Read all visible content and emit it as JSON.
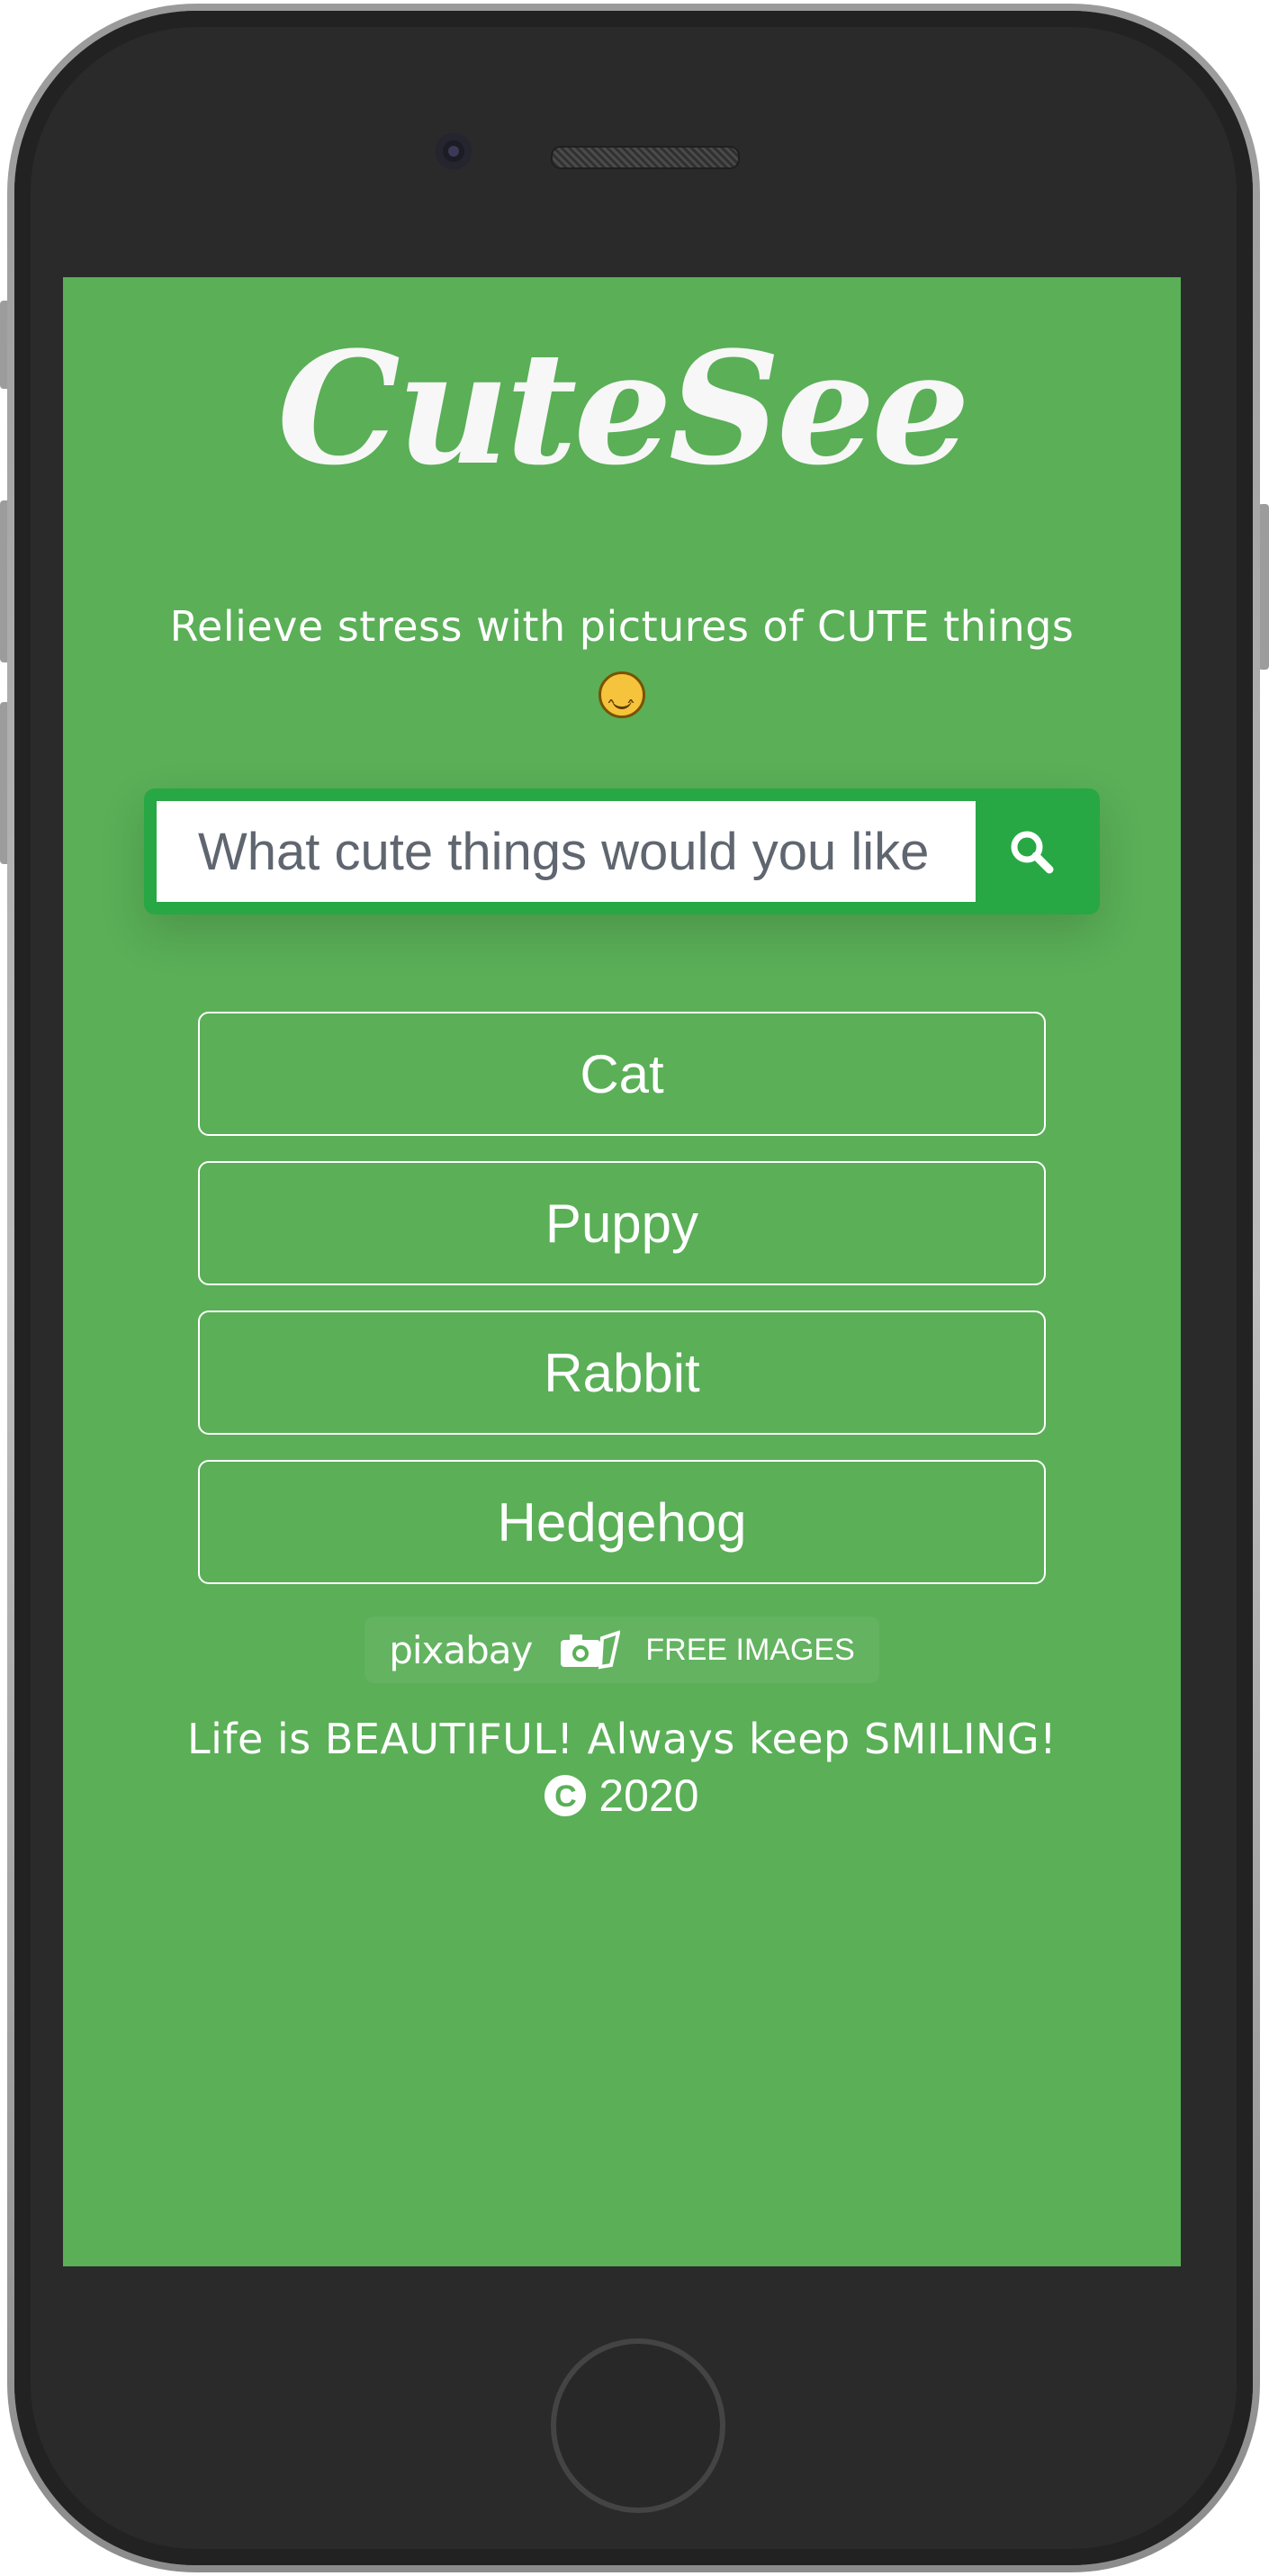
{
  "app": {
    "logo": "CuteSee",
    "tagline": "Relieve stress with pictures of CUTE things"
  },
  "search": {
    "placeholder": "What cute things would you like"
  },
  "suggestions": [
    "Cat",
    "Puppy",
    "Rabbit",
    "Hedgehog"
  ],
  "pixabay": {
    "brand": "pixabay",
    "label": "FREE IMAGES"
  },
  "footer": {
    "message": "Life is BEAUTIFUL! Always keep SMILING!",
    "year": "2020"
  },
  "colors": {
    "background": "#5aaf57",
    "search_bar": "#28a745",
    "text": "#ffffff"
  },
  "icons": [
    "smiling-face-icon",
    "search-icon",
    "camera-icon",
    "copyright-icon"
  ]
}
